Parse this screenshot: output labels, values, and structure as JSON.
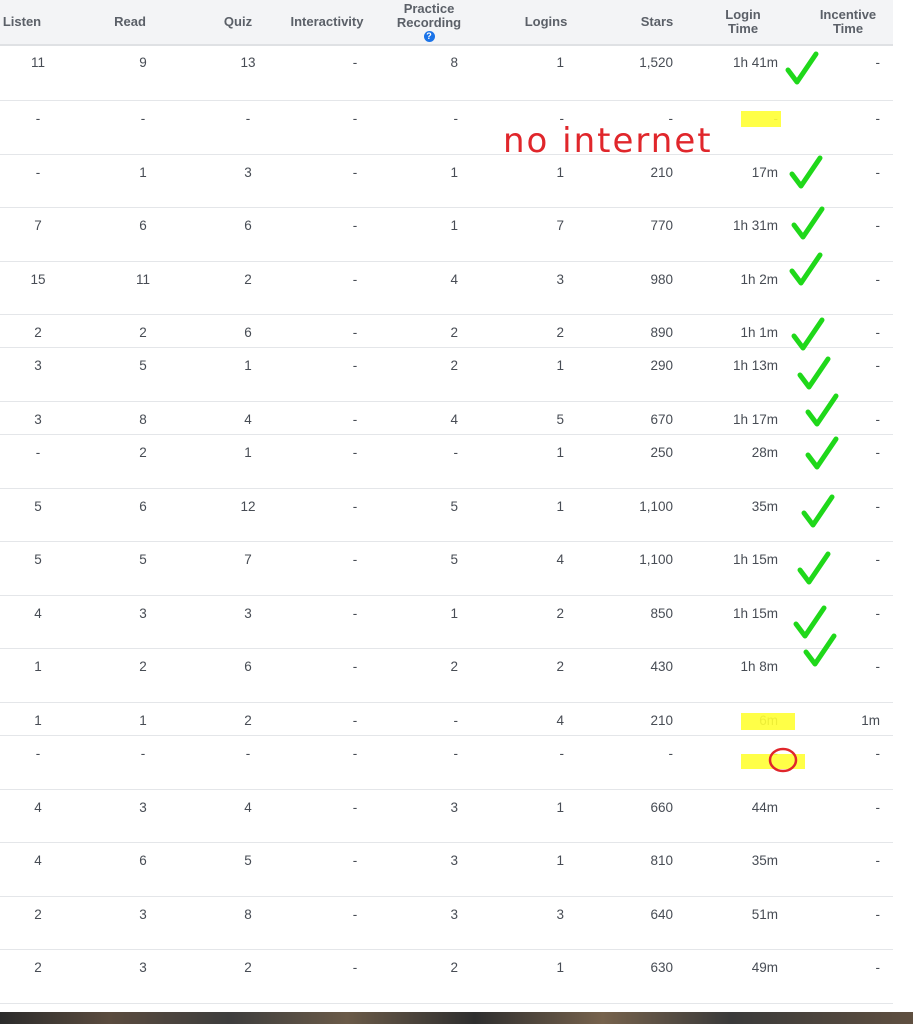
{
  "columns": [
    {
      "key": "listen",
      "lines": [
        "Listen"
      ]
    },
    {
      "key": "read",
      "lines": [
        "Read"
      ]
    },
    {
      "key": "quiz",
      "lines": [
        "Quiz"
      ]
    },
    {
      "key": "interactivity",
      "lines": [
        "Interactivity"
      ]
    },
    {
      "key": "practice",
      "lines": [
        "Practice",
        "Recording"
      ],
      "info_icon": "question-circle-icon"
    },
    {
      "key": "logins",
      "lines": [
        "Logins"
      ]
    },
    {
      "key": "stars",
      "lines": [
        "Stars"
      ]
    },
    {
      "key": "login_time",
      "lines": [
        "Login",
        "Time"
      ]
    },
    {
      "key": "incentive",
      "lines": [
        "Incentive",
        "Time"
      ]
    }
  ],
  "info_icon_glyph": "?",
  "rows": [
    [
      "11",
      "9",
      "13",
      "-",
      "8",
      "1",
      "1,520",
      "1h 41m",
      "-"
    ],
    [
      "-",
      "-",
      "-",
      "-",
      "-",
      "-",
      "-",
      "-",
      "-"
    ],
    [
      "-",
      "1",
      "3",
      "-",
      "1",
      "1",
      "210",
      "17m",
      "-"
    ],
    [
      "7",
      "6",
      "6",
      "-",
      "1",
      "7",
      "770",
      "1h 31m",
      "-"
    ],
    [
      "15",
      "11",
      "2",
      "-",
      "4",
      "3",
      "980",
      "1h 2m",
      "-"
    ],
    [
      "2",
      "2",
      "6",
      "-",
      "2",
      "2",
      "890",
      "1h 1m",
      "-"
    ],
    [
      "3",
      "5",
      "1",
      "-",
      "2",
      "1",
      "290",
      "1h 13m",
      "-"
    ],
    [
      "3",
      "8",
      "4",
      "-",
      "4",
      "5",
      "670",
      "1h 17m",
      "-"
    ],
    [
      "-",
      "2",
      "1",
      "-",
      "-",
      "1",
      "250",
      "28m",
      "-"
    ],
    [
      "5",
      "6",
      "12",
      "-",
      "5",
      "1",
      "1,100",
      "35m",
      "-"
    ],
    [
      "5",
      "5",
      "7",
      "-",
      "5",
      "4",
      "1,100",
      "1h 15m",
      "-"
    ],
    [
      "4",
      "3",
      "3",
      "-",
      "1",
      "2",
      "850",
      "1h 15m",
      "-"
    ],
    [
      "1",
      "2",
      "6",
      "-",
      "2",
      "2",
      "430",
      "1h 8m",
      "-"
    ],
    [
      "1",
      "1",
      "2",
      "-",
      "-",
      "4",
      "210",
      "6m",
      "1m"
    ],
    [
      "-",
      "-",
      "-",
      "-",
      "-",
      "-",
      "-",
      "-",
      "-"
    ],
    [
      "4",
      "3",
      "4",
      "-",
      "3",
      "1",
      "660",
      "44m",
      "-"
    ],
    [
      "4",
      "6",
      "5",
      "-",
      "3",
      "1",
      "810",
      "35m",
      "-"
    ],
    [
      "2",
      "3",
      "8",
      "-",
      "3",
      "3",
      "640",
      "51m",
      "-"
    ],
    [
      "2",
      "3",
      "2",
      "-",
      "2",
      "1",
      "630",
      "49m",
      "-"
    ]
  ],
  "annotations": {
    "note": "no internet",
    "note_color": "#e0262b",
    "check_color": "#1fd81a",
    "highlight_color": "#ffff33",
    "check_rows": [
      0,
      2,
      3,
      4,
      5,
      6,
      7,
      8,
      9,
      10,
      11,
      12
    ],
    "highlight_rows": [
      1,
      13,
      14
    ],
    "circle_row": 14
  }
}
